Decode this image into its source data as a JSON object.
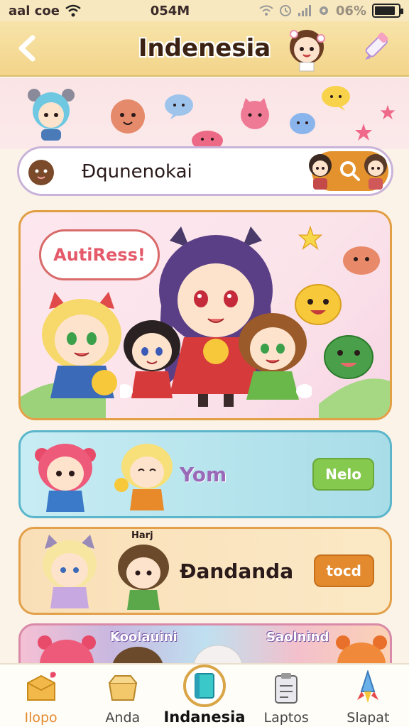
{
  "status_bar": {
    "carrier": "aal coe",
    "time": "054M",
    "battery_text": "06%"
  },
  "header": {
    "title": "Indenesia"
  },
  "search": {
    "value": "Đqunenokai"
  },
  "banner": {
    "speech_text": "AutiRess!"
  },
  "cards": [
    {
      "label": "Yom",
      "button": "Nelo",
      "button_color": "#86c94f"
    },
    {
      "label": "Đandanda",
      "button": "tocd",
      "button_color": "#e38a2f",
      "tag": "Harj"
    }
  ],
  "strip": {
    "labels": [
      "Koolauini",
      "Saolnind"
    ]
  },
  "nav": {
    "items": [
      {
        "label": "Ilopo",
        "icon": "box-gift-icon"
      },
      {
        "label": "Anda",
        "icon": "open-box-icon"
      },
      {
        "label": "Indanesia",
        "icon": "book-icon",
        "active": true
      },
      {
        "label": "Laptos",
        "icon": "clipboard-icon"
      },
      {
        "label": "Slapat",
        "icon": "rocket-icon"
      }
    ]
  },
  "colors": {
    "header_bg": "#f3d58a",
    "accent_orange": "#e3922d",
    "card_blue": "#a8dde8",
    "card_orange": "#fbe9c5",
    "button_green": "#86c94f"
  }
}
